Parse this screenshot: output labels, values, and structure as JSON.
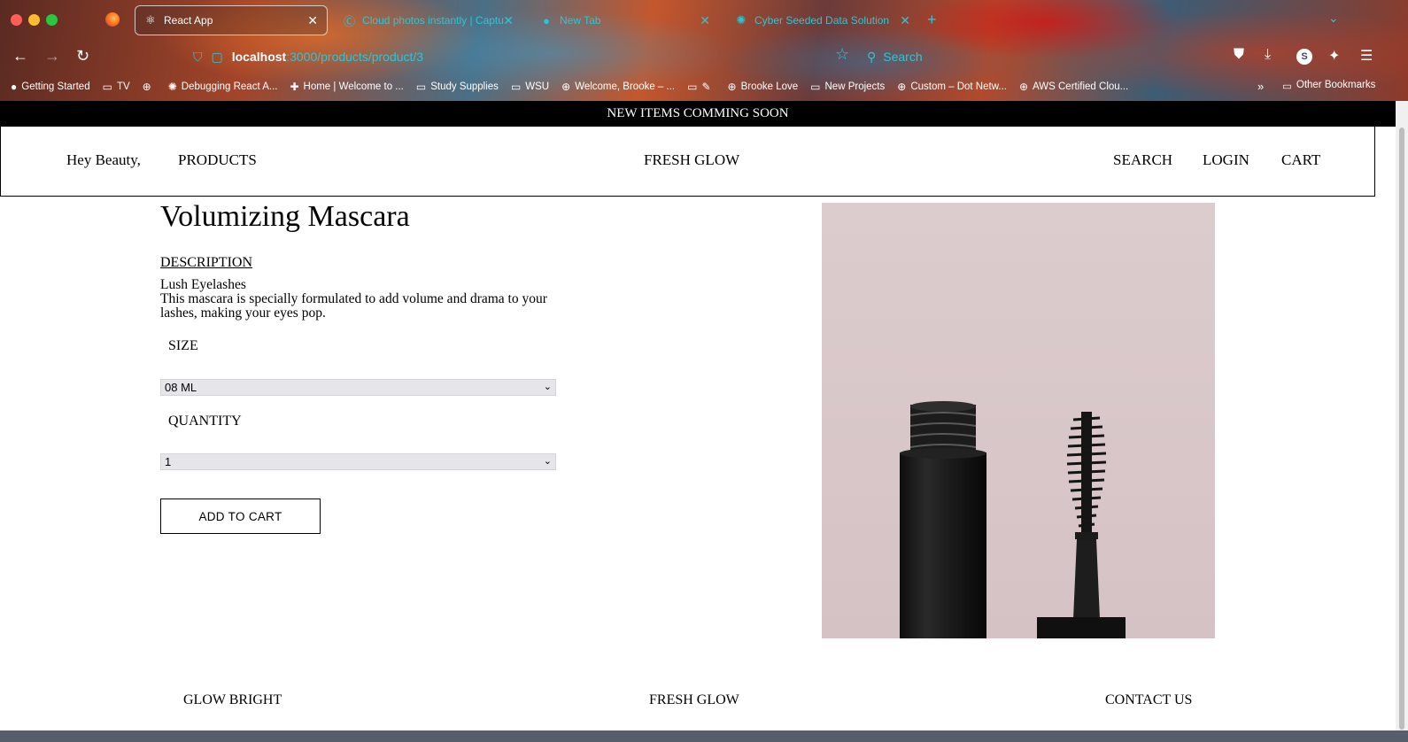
{
  "browser": {
    "tabs": [
      {
        "label": "React App",
        "active": true
      },
      {
        "label": "Cloud photos instantly | Capture",
        "active": false
      },
      {
        "label": "New Tab",
        "active": false
      },
      {
        "label": "Cyber Seeded Data Solution",
        "active": false
      }
    ],
    "url_host": "localhost",
    "url_path": ":3000/products/product/3",
    "search_placeholder": "Search",
    "profile_initial": "S",
    "bookmarks": [
      "Getting Started",
      "TV",
      "",
      "Debugging React A...",
      "Home | Welcome to ...",
      "Study Supplies",
      "WSU",
      "Welcome, Brooke – ...",
      "",
      "Brooke Love",
      "New Projects",
      "Custom – Dot Netw...",
      "AWS Certified Clou..."
    ],
    "other_bookmarks": "Other Bookmarks"
  },
  "site": {
    "announcement": "NEW ITEMS COMMING SOON",
    "header": {
      "greeting": "Hey Beauty,",
      "products": "PRODUCTS",
      "brand": "FRESH GLOW",
      "search": "SEARCH",
      "login": "LOGIN",
      "cart": "CART"
    },
    "product": {
      "title": "Volumizing Mascara",
      "description_heading": "DESCRIPTION",
      "tagline": "Lush Eyelashes",
      "description": "This mascara is specially formulated to add volume and drama to your lashes, making your eyes pop.",
      "size_label": "SIZE",
      "size_value": "08 ML",
      "quantity_label": "QUANTITY",
      "quantity_value": "1",
      "add_to_cart": "ADD TO CART"
    },
    "footer": {
      "left": "GLOW BRIGHT",
      "center": "FRESH GLOW",
      "right": "CONTACT US"
    }
  }
}
